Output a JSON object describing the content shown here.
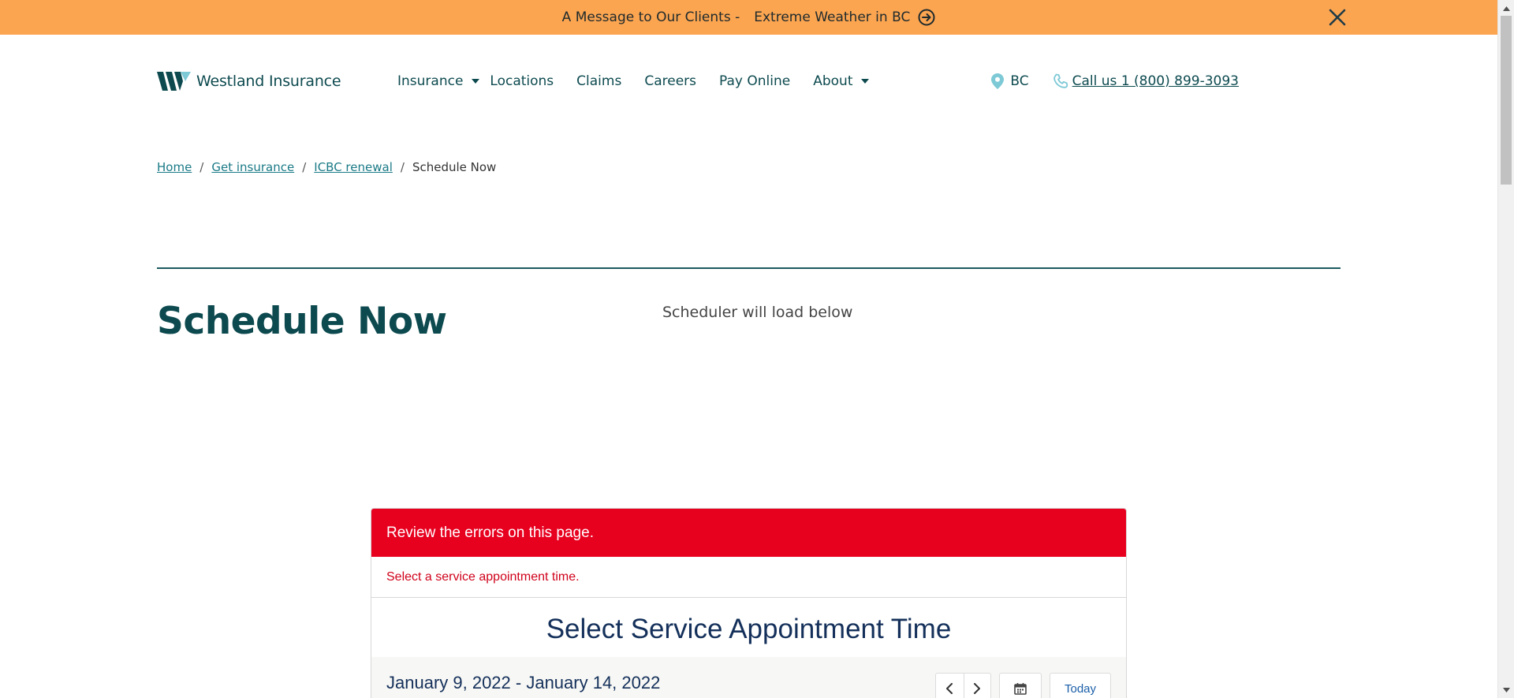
{
  "banner": {
    "message": "A Message to Our Clients -",
    "link_text": "Extreme Weather in BC",
    "bg_color": "#fba551"
  },
  "header": {
    "logo_text": "Westland Insurance",
    "nav": {
      "insurance": "Insurance",
      "locations": "Locations",
      "claims": "Claims",
      "careers": "Careers",
      "pay_online": "Pay Online",
      "about": "About"
    },
    "region": "BC",
    "phone": "Call us 1 (800) 899-3093"
  },
  "breadcrumb": {
    "home": "Home",
    "get_insurance": "Get insurance",
    "icbc_renewal": "ICBC renewal",
    "current": "Schedule Now"
  },
  "main": {
    "title": "Schedule Now",
    "note": "Scheduler will load below"
  },
  "scheduler": {
    "error_title": "Review the errors on this page.",
    "error_detail": "Select a service appointment time.",
    "title": "Select Service Appointment Time",
    "date_range": "January 9, 2022 - January 14, 2022",
    "today_label": "Today",
    "error_color": "#e8001f"
  }
}
